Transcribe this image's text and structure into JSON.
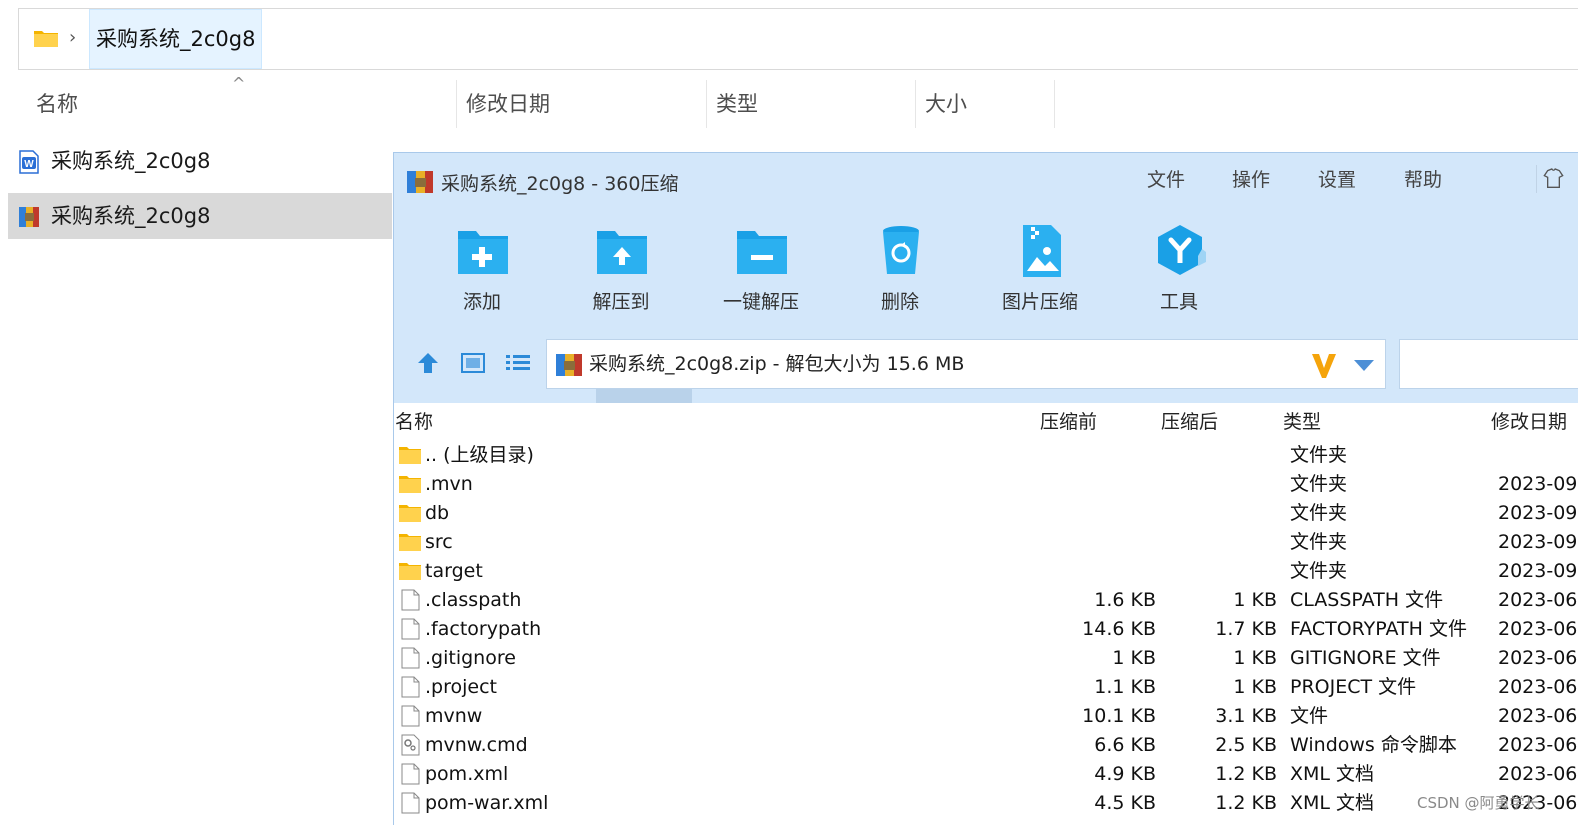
{
  "explorer": {
    "breadcrumb": "采购系统_2c0g8",
    "columns": {
      "name": "名称",
      "modified": "修改日期",
      "type": "类型",
      "size": "大小"
    },
    "files": [
      {
        "name": "采购系统_2c0g8",
        "icon": "wps-doc-icon"
      },
      {
        "name": "采购系统_2c0g8",
        "icon": "zip-archive-icon",
        "selected": true
      }
    ]
  },
  "zip_window": {
    "title": "采购系统_2c0g8 - 360压缩",
    "menu": [
      "文件",
      "操作",
      "设置",
      "帮助"
    ],
    "toolbar": [
      {
        "label": "添加",
        "icon": "add-folder-icon"
      },
      {
        "label": "解压到",
        "icon": "extract-to-icon"
      },
      {
        "label": "一键解压",
        "icon": "one-click-extract-icon"
      },
      {
        "label": "删除",
        "icon": "recycle-bin-icon"
      },
      {
        "label": "图片压缩",
        "icon": "image-compress-icon"
      },
      {
        "label": "工具",
        "icon": "tools-icon"
      }
    ],
    "path_text": "采购系统_2c0g8.zip - 解包大小为 15.6 MB",
    "list_headers": {
      "name": "名称",
      "original": "压缩前",
      "compressed": "压缩后",
      "type": "类型",
      "modified": "修改日期"
    },
    "rows": [
      {
        "name": ".. (上级目录)",
        "kind": "folder",
        "size": "",
        "comp": "",
        "type": "文件夹",
        "date": ""
      },
      {
        "name": ".mvn",
        "kind": "folder",
        "size": "",
        "comp": "",
        "type": "文件夹",
        "date": "2023-09"
      },
      {
        "name": "db",
        "kind": "folder",
        "size": "",
        "comp": "",
        "type": "文件夹",
        "date": "2023-09"
      },
      {
        "name": "src",
        "kind": "folder",
        "size": "",
        "comp": "",
        "type": "文件夹",
        "date": "2023-09"
      },
      {
        "name": "target",
        "kind": "folder",
        "size": "",
        "comp": "",
        "type": "文件夹",
        "date": "2023-09"
      },
      {
        "name": ".classpath",
        "kind": "file",
        "size": "1.6 KB",
        "comp": "1 KB",
        "type": "CLASSPATH 文件",
        "date": "2023-06"
      },
      {
        "name": ".factorypath",
        "kind": "file",
        "size": "14.6 KB",
        "comp": "1.7 KB",
        "type": "FACTORYPATH 文件",
        "date": "2023-06"
      },
      {
        "name": ".gitignore",
        "kind": "file",
        "size": "1 KB",
        "comp": "1 KB",
        "type": "GITIGNORE 文件",
        "date": "2023-06"
      },
      {
        "name": ".project",
        "kind": "file",
        "size": "1.1 KB",
        "comp": "1 KB",
        "type": "PROJECT 文件",
        "date": "2023-06"
      },
      {
        "name": "mvnw",
        "kind": "file",
        "size": "10.1 KB",
        "comp": "3.1 KB",
        "type": "文件",
        "date": "2023-06"
      },
      {
        "name": "mvnw.cmd",
        "kind": "cmd",
        "size": "6.6 KB",
        "comp": "2.5 KB",
        "type": "Windows 命令脚本",
        "date": "2023-06"
      },
      {
        "name": "pom.xml",
        "kind": "file",
        "size": "4.9 KB",
        "comp": "1.2 KB",
        "type": "XML 文档",
        "date": "2023-06"
      },
      {
        "name": "pom-war.xml",
        "kind": "file",
        "size": "4.5 KB",
        "comp": "1.2 KB",
        "type": "XML 文档",
        "date": "2023-06"
      }
    ]
  },
  "watermark": "CSDN @阿勇学长",
  "colors": {
    "accent_blue": "#1aa0e6",
    "window_bg": "#d3e7fa",
    "folder_yellow": "#ffc83d",
    "selection": "#d9d9d9"
  }
}
